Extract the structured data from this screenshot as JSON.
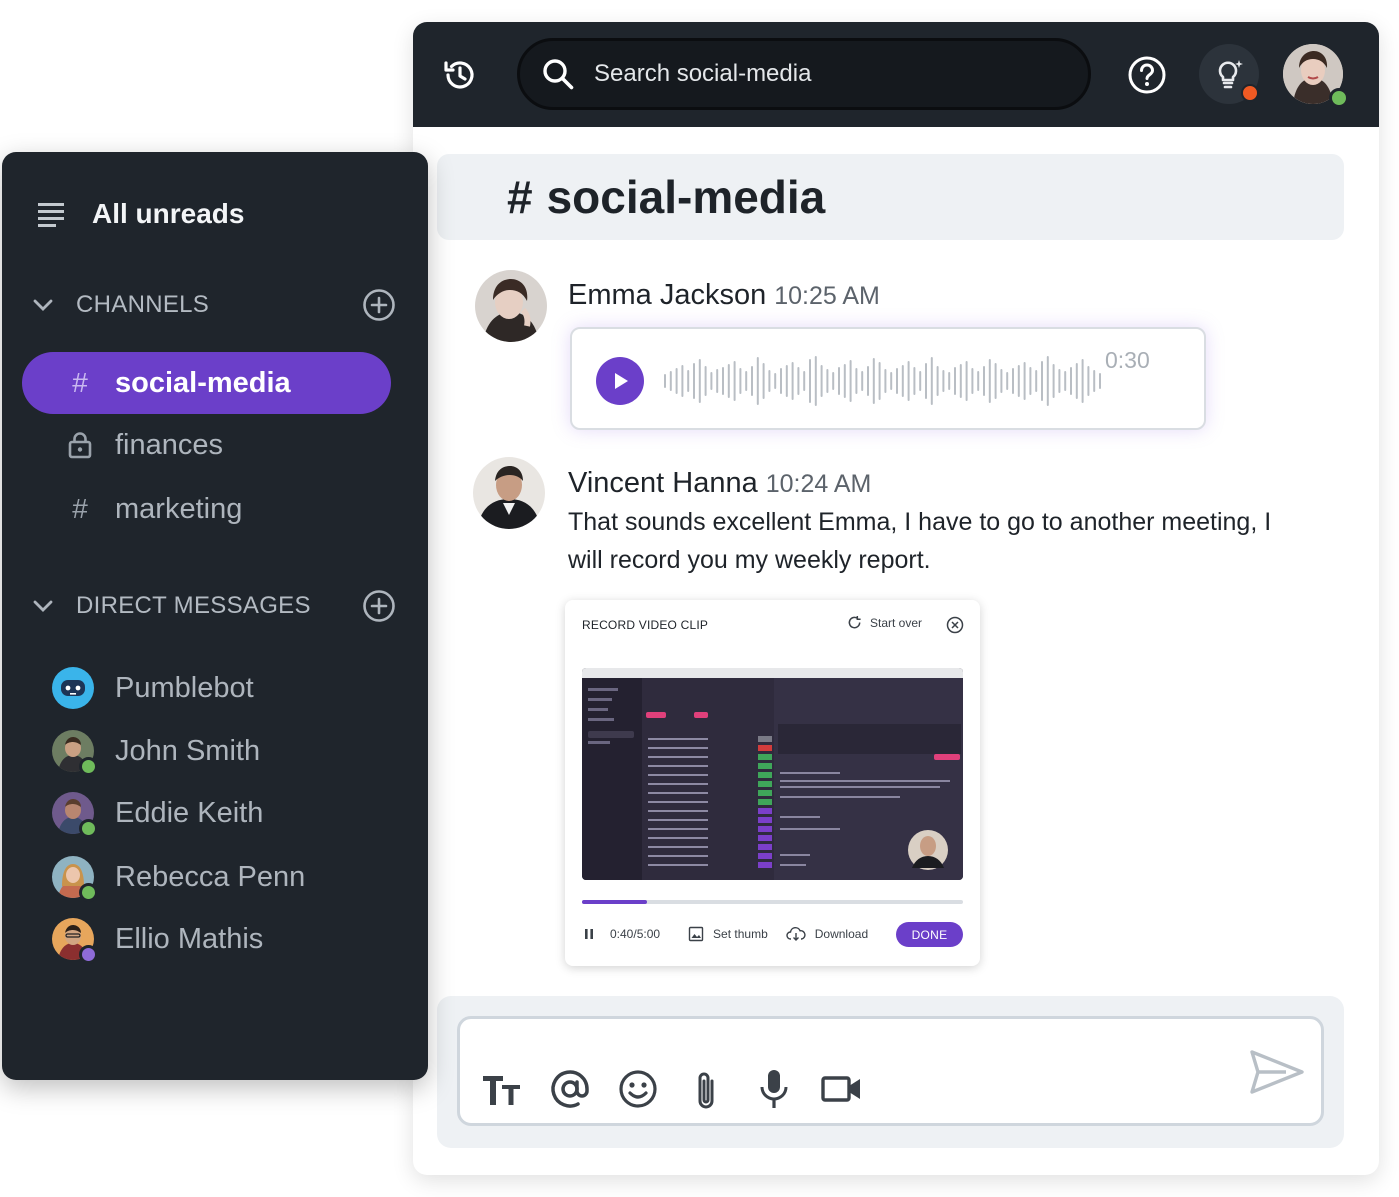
{
  "search": {
    "placeholder": "Search social-media"
  },
  "channel": {
    "hash": "#",
    "name": "social-media"
  },
  "messages": [
    {
      "author": "Emma Jackson",
      "time": "10:25 AM",
      "voice_duration": "0:30"
    },
    {
      "author": "Vincent Hanna",
      "time": "10:24 AM",
      "text": "That sounds excellent Emma, I have to go to another meeting, I will record you my weekly report."
    }
  ],
  "video_clip": {
    "title": "RECORD VIDEO CLIP",
    "start_over": "Start over",
    "time": "0:40/5:00",
    "progress": 0.17,
    "set_thumb": "Set thumb",
    "download": "Download",
    "done": "DONE"
  },
  "sidebar": {
    "title": "All unreads",
    "channels_label": "CHANNELS",
    "channels": [
      {
        "symbol": "#",
        "name": "social-media",
        "active": true
      },
      {
        "symbol": "lock-icon",
        "name": "finances",
        "active": false
      },
      {
        "symbol": "#",
        "name": "marketing",
        "active": false
      }
    ],
    "dm_label": "DIRECT MESSAGES",
    "direct_messages": [
      {
        "name": "Pumblebot"
      },
      {
        "name": "John Smith"
      },
      {
        "name": "Eddie Keith"
      },
      {
        "name": "Rebecca Penn"
      },
      {
        "name": "Ellio Mathis"
      }
    ]
  },
  "colors": {
    "accent": "#6b3fc9",
    "dark_bg": "#1f252c",
    "online": "#6fbb5b",
    "notification": "#f05a23"
  }
}
